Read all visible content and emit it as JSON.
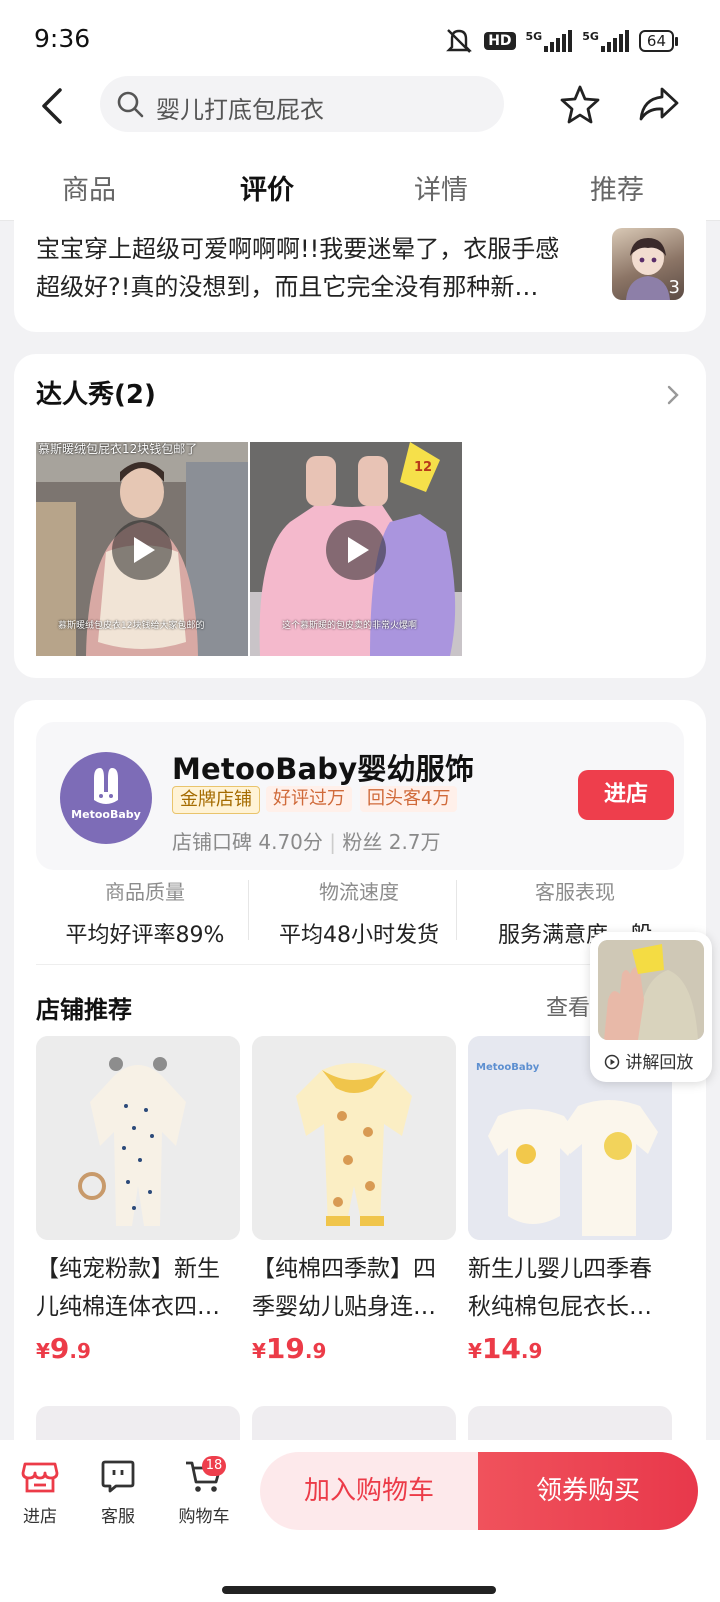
{
  "status_bar": {
    "time": "9:36",
    "hd_label": "HD",
    "network_1": "5G",
    "network_2": "5G",
    "battery": "64"
  },
  "header": {
    "search_text": "婴儿打底包屁衣"
  },
  "tabs": [
    {
      "label": "商品",
      "active": false
    },
    {
      "label": "评价",
      "active": true
    },
    {
      "label": "详情",
      "active": false
    },
    {
      "label": "推荐",
      "active": false
    }
  ],
  "review": {
    "text": "宝宝穿上超级可爱啊啊啊!!我要迷晕了，衣服手感超级好?!真的没想到，而且它完全没有那种新…",
    "image_count": "3"
  },
  "experts": {
    "title": "达人秀(2)",
    "videos": [
      {
        "caption_top": "慕斯暖绒包屁衣12块钱包邮了",
        "caption_bottom": "慕斯暖绒包皮衣12块钱给大家包邮的"
      },
      {
        "caption_top": "",
        "caption_bottom": "这个慕斯暖的包皮卖的非常火爆啊",
        "tag_text": "12"
      }
    ]
  },
  "shop": {
    "name": "MetooBaby婴幼服饰",
    "logo_text": "MetooBaby",
    "badges": [
      "金牌店铺",
      "好评过万",
      "回头客4万"
    ],
    "rating": "店铺口碑 4.70分",
    "fans": "粉丝 2.7万",
    "enter_label": "进店",
    "metrics": [
      {
        "label": "商品质量",
        "value": "平均好评率89%"
      },
      {
        "label": "物流速度",
        "value": "平均48小时发货"
      },
      {
        "label": "客服表现",
        "value": "服务满意度一般"
      }
    ]
  },
  "recommend": {
    "title": "店铺推荐",
    "more_label": "查看",
    "products": [
      {
        "name": "【纯宠粉款】新生儿纯棉连体衣四…",
        "price_symbol": "¥",
        "price_int": "9",
        "price_dec": ".9"
      },
      {
        "name": "【纯棉四季款】四季婴幼儿贴身连…",
        "price_symbol": "¥",
        "price_int": "19",
        "price_dec": ".9"
      },
      {
        "name": "新生儿婴儿四季春秋纯棉包屁衣长…",
        "price_symbol": "¥",
        "price_int": "14",
        "price_dec": ".9",
        "brand_mark": "MetooBaby"
      }
    ]
  },
  "replay": {
    "label": "讲解回放"
  },
  "bottom_bar": {
    "store_label": "进店",
    "service_label": "客服",
    "cart_label": "购物车",
    "cart_count": "18",
    "add_cart_label": "加入购物车",
    "buy_label": "领券购买"
  },
  "colors": {
    "accent": "#ee3e4c",
    "price": "#ec3b48",
    "logo_bg": "#7d6cb7",
    "gold_badge": "#a46b00"
  }
}
